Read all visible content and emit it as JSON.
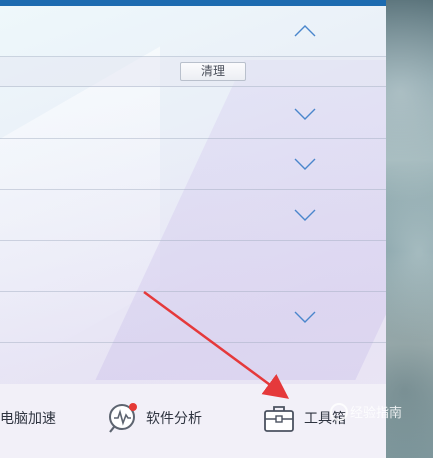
{
  "panel": {
    "clean_label": "清理"
  },
  "bottom_bar": {
    "items": [
      {
        "label": "电脑加速",
        "icon": "speedometer-icon"
      },
      {
        "label": "软件分析",
        "icon": "software-analysis-icon"
      },
      {
        "label": "工具箱",
        "icon": "toolbox-icon"
      }
    ]
  },
  "watermark": {
    "text": "经验指南"
  },
  "colors": {
    "accent": "#1d6bb0",
    "chevron": "#4a86cc",
    "annotation_arrow": "#e5393b"
  }
}
